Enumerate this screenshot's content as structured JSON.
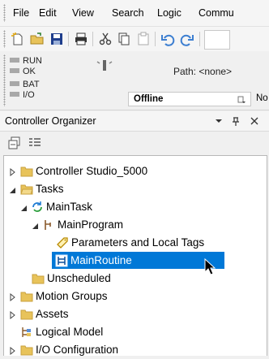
{
  "menu": [
    "File",
    "Edit",
    "View",
    "Search",
    "Logic",
    "Commu"
  ],
  "toolbar_icons": [
    "new-file-icon",
    "open-folder-icon",
    "save-icon",
    "print-icon",
    "cut-icon",
    "copy-icon",
    "paste-icon",
    "undo-icon",
    "redo-icon"
  ],
  "status": {
    "indicators": [
      "RUN",
      "OK",
      "BAT",
      "I/O"
    ],
    "path_label": "Path: <none>",
    "mode": "Offline",
    "mode_extra": "No"
  },
  "organizer": {
    "title": "Controller Organizer",
    "pin": "↕",
    "tree": [
      {
        "label": "Controller Studio_5000",
        "icon": "folder-icon",
        "expanded": false
      },
      {
        "label": "Tasks",
        "icon": "open-folder-icon",
        "expanded": true
      },
      {
        "label": "MainTask",
        "icon": "task-cycle-icon",
        "expanded": true
      },
      {
        "label": "MainProgram",
        "icon": "program-icon",
        "expanded": true
      },
      {
        "label": "Parameters and Local Tags",
        "icon": "tag-icon"
      },
      {
        "label": "MainRoutine",
        "icon": "ladder-routine-icon",
        "selected": true
      },
      {
        "label": "Unscheduled",
        "icon": "folder-icon"
      },
      {
        "label": "Motion Groups",
        "icon": "folder-icon",
        "expanded": false
      },
      {
        "label": "Assets",
        "icon": "folder-icon",
        "expanded": false
      },
      {
        "label": "Logical Model",
        "icon": "logical-model-icon"
      },
      {
        "label": "I/O Configuration",
        "icon": "folder-icon",
        "expanded": false
      }
    ]
  },
  "colors": {
    "selection": "#0078d7",
    "folder": "#e8c35a",
    "task": "#1e7bd3",
    "tag": "#e0b400"
  }
}
